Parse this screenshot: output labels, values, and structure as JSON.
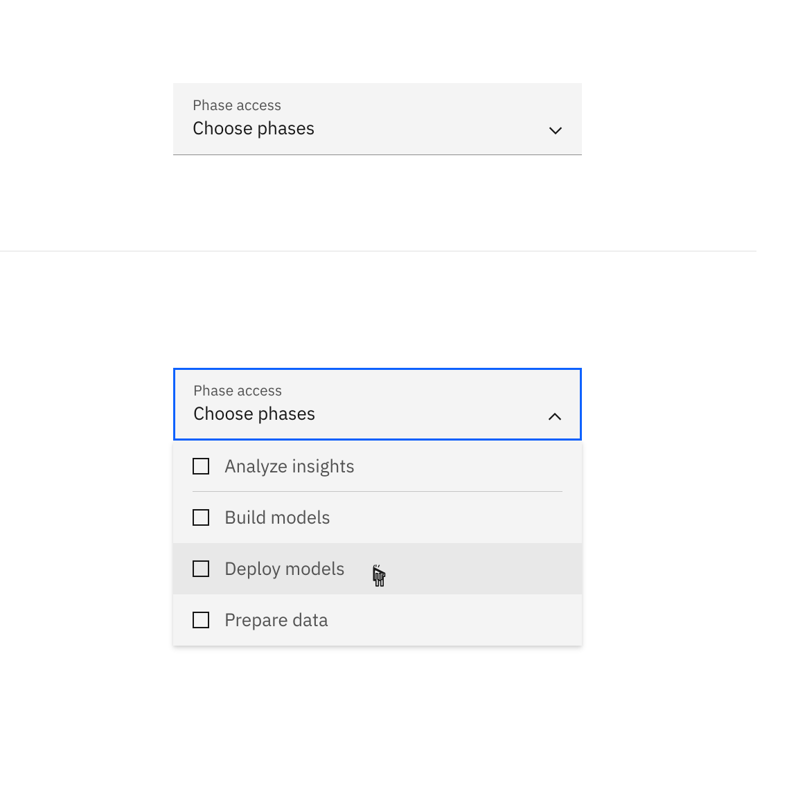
{
  "dropdown_closed": {
    "label": "Phase access",
    "value": "Choose phases"
  },
  "dropdown_open": {
    "label": "Phase access",
    "value": "Choose phases",
    "options": [
      {
        "label": "Analyze insights",
        "checked": false,
        "hovered": false
      },
      {
        "label": "Build models",
        "checked": false,
        "hovered": false
      },
      {
        "label": "Deploy models",
        "checked": false,
        "hovered": true
      },
      {
        "label": "Prepare data",
        "checked": false,
        "hovered": false
      }
    ]
  }
}
